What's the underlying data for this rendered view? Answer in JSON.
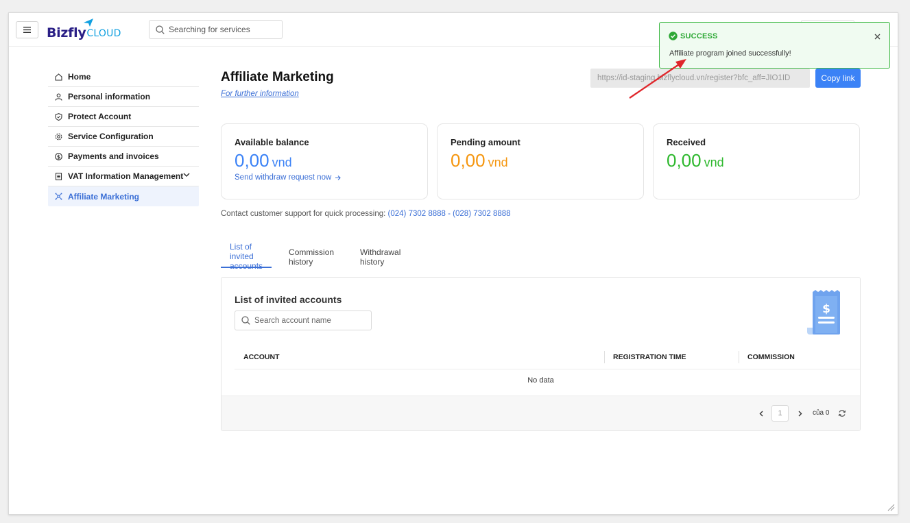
{
  "brand": {
    "logo_part1": "Bizfly",
    "logo_part2": "CLOUD"
  },
  "topbar": {
    "search_placeholder": "Searching for services"
  },
  "sidebar": {
    "items": [
      {
        "label": "Home",
        "icon": "home-icon"
      },
      {
        "label": "Personal information",
        "icon": "user-icon"
      },
      {
        "label": "Protect Account",
        "icon": "shield-icon"
      },
      {
        "label": "Service Configuration",
        "icon": "gear-icon"
      },
      {
        "label": "Payments and invoices",
        "icon": "dollar-icon"
      },
      {
        "label": "VAT Information Management",
        "icon": "invoice-icon"
      },
      {
        "label": "Affiliate Marketing",
        "icon": "affiliate-icon",
        "active": true
      }
    ]
  },
  "main": {
    "title": "Affiliate Marketing",
    "further_link": "For further information",
    "referral_link": "https://id-staging.bizflycloud.vn/register?bfc_aff=JIO1ID",
    "copy_button": "Copy link",
    "cards": {
      "available": {
        "label": "Available balance",
        "amount": "0,00",
        "unit": "vnd",
        "action": "Send withdraw request now"
      },
      "pending": {
        "label": "Pending amount",
        "amount": "0,00",
        "unit": "vnd"
      },
      "received": {
        "label": "Received",
        "amount": "0,00",
        "unit": "vnd"
      }
    },
    "contact": {
      "text": "Contact customer support for quick processing: ",
      "phone1": "(024) 7302 8888",
      "separator": " - ",
      "phone2": "(028) 7302 8888"
    },
    "tabs": [
      {
        "label": "List of invited accounts",
        "active": true
      },
      {
        "label": "Commission history"
      },
      {
        "label": "Withdrawal history"
      }
    ],
    "panel": {
      "title": "List of invited accounts",
      "search_placeholder": "Search account name",
      "columns": [
        "ACCOUNT",
        "REGISTRATION TIME",
        "COMMISSION"
      ],
      "empty_text": "No data",
      "pagination": {
        "current_page": "1",
        "of_label": "của 0"
      }
    }
  },
  "toast": {
    "type": "SUCCESS",
    "message": "Affiliate program joined successfully!"
  },
  "colors": {
    "primary": "#3b82f6",
    "pending": "#f5960f",
    "received": "#2eb82e",
    "toast_border": "#3db843",
    "annotation_arrow": "#e0262b"
  }
}
